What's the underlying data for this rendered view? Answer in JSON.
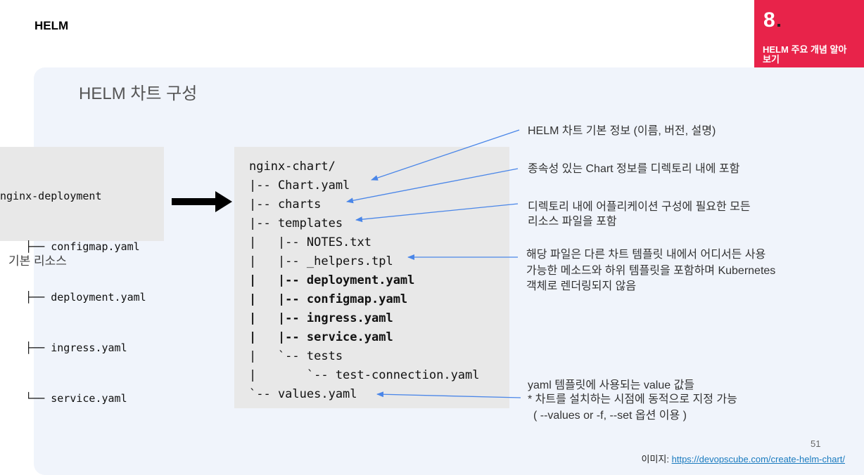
{
  "header": {
    "title": "HELM"
  },
  "badge": {
    "number": "8",
    "subtitle": "HELM 주요 개념 알아보기"
  },
  "panel": {
    "title": "HELM 차트 구성"
  },
  "left_tree": {
    "lines": [
      "nginx-deployment",
      "    ├── configmap.yaml",
      "    ├── deployment.yaml",
      "    ├── ingress.yaml",
      "    └── service.yaml"
    ],
    "label": "기본 리소스"
  },
  "chart_tree": {
    "lines": [
      {
        "text": "nginx-chart/",
        "bold": false
      },
      {
        "text": "|-- Chart.yaml",
        "bold": false
      },
      {
        "text": "|-- charts",
        "bold": false
      },
      {
        "text": "|-- templates",
        "bold": false
      },
      {
        "text": "|   |-- NOTES.txt",
        "bold": false
      },
      {
        "text": "|   |-- _helpers.tpl",
        "bold": false
      },
      {
        "text": "|   |-- deployment.yaml",
        "bold": true
      },
      {
        "text": "|   |-- configmap.yaml",
        "bold": true
      },
      {
        "text": "|   |-- ingress.yaml",
        "bold": true
      },
      {
        "text": "|   |-- service.yaml",
        "bold": true
      },
      {
        "text": "|   `-- tests",
        "bold": false
      },
      {
        "text": "|       `-- test-connection.yaml",
        "bold": false
      },
      {
        "text": "`-- values.yaml",
        "bold": false
      }
    ]
  },
  "notes": {
    "chart_yaml": "HELM 차트 기본 정보 (이름, 버전, 설명)",
    "charts": "종속성 있는 Chart 정보를 디렉토리 내에 포함",
    "templates_1": "디렉토리 내에 어플리케이션 구성에 필요한 모든",
    "templates_2": "리소스 파일을 포함",
    "helpers_1": "해당 파일은 다른 차트 템플릿 내에서 어디서든 사용",
    "helpers_2": "가능한 메소드와 하위 템플릿을 포함하며 Kubernetes",
    "helpers_3": "객체로 렌더링되지 않음",
    "values_1": "yaml 템플릿에 사용되는 value 값들",
    "values_2": "* 차트를 설치하는 시점에 동적으로 지정 가능",
    "values_3": "( --values or -f, --set 옵션 이용 )"
  },
  "footer": {
    "page_number": "51",
    "credit_label": "이미지: ",
    "credit_link": "https://devopscube.com/create-helm-chart/"
  },
  "colors": {
    "badge": "#e8234a",
    "arrow": "#4a86e8",
    "panel": "#f0f4fb"
  }
}
